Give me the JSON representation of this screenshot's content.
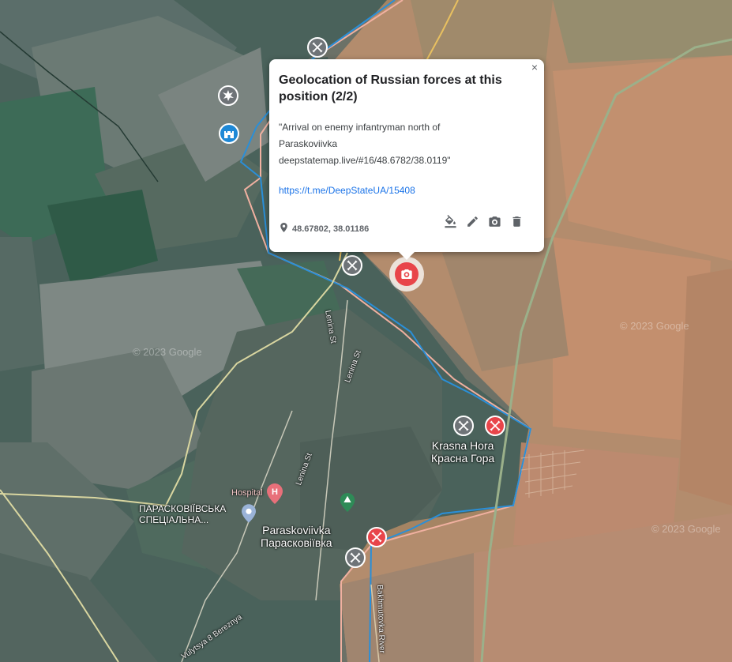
{
  "popup": {
    "title": "Geolocation of Russian forces at this position (2/2)",
    "description_line1": "\"Arrival on enemy infantryman north of",
    "description_line2": "Paraskoviivka",
    "description_line3": "deepstatemap.live/#16/48.6782/38.0119\"",
    "link": "https://t.me/DeepStateUA/15408",
    "coords": "48.67802, 38.01186",
    "close_symbol": "×",
    "tools": [
      "paint-bucket-icon",
      "pencil-icon",
      "camera-icon",
      "trash-icon"
    ]
  },
  "places": {
    "krasna_hora_latin": "Krasna Hora",
    "krasna_hora_cyr": "Красна Гора",
    "paraskoviivka_latin": "Paraskoviivka",
    "paraskoviivka_cyr": "Парасковіївка",
    "school_line1": "ПАРАСКОВІЇВСЬКА",
    "school_line2": "СПЕЦІАЛЬНА...",
    "hospital": "Hospital"
  },
  "streets": {
    "lenina_1": "Lenina St",
    "lenina_2": "Lenina St",
    "lenina_3": "Lenina St",
    "vulytsya": "Vulytsya 8 Bereznya",
    "bakhmutovka": "Bakhmutovka River"
  },
  "watermarks": {
    "w1": "© 2023 Google",
    "w2": "© 2023 Google",
    "w3": "© 2023 Google"
  },
  "colors": {
    "russian_control": "#f4a28a",
    "ukrainian_line": "#2a8fd8",
    "marker_red": "#e8454a",
    "marker_grey": "#6f7478",
    "link": "#1a73e8"
  }
}
